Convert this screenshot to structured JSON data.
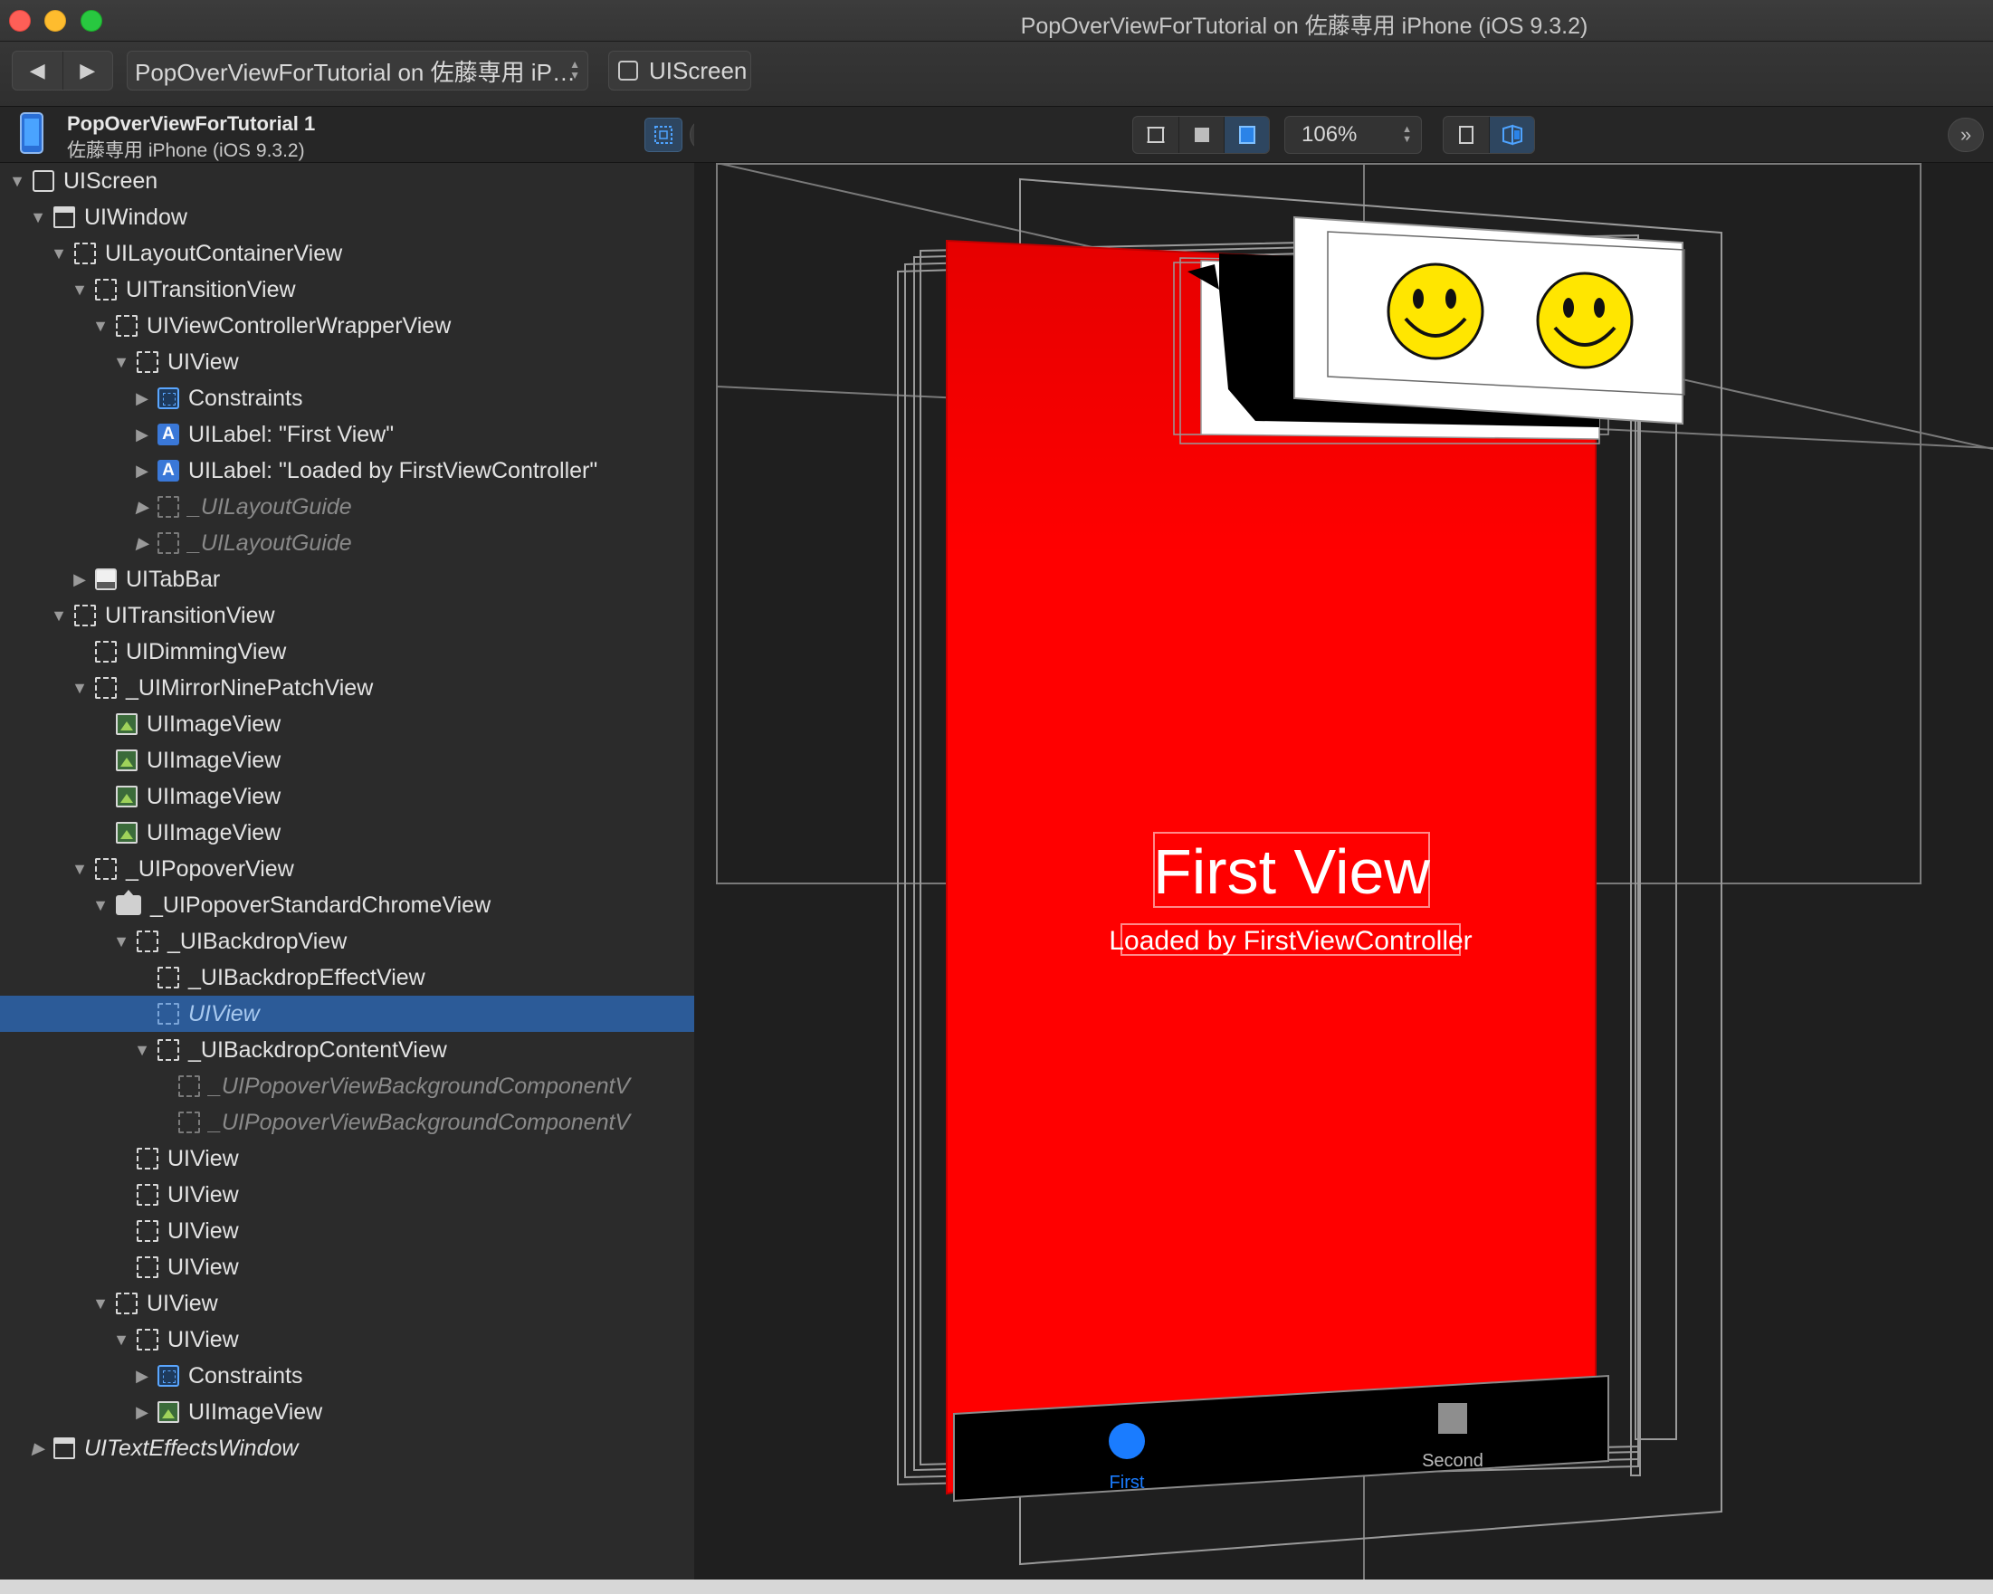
{
  "window": {
    "title": "PopOverViewForTutorial on 佐藤専用 iPhone (iOS 9.3.2)"
  },
  "toolbar": {
    "back_icon": "back-arrow-icon",
    "forward_icon": "forward-arrow-icon",
    "crumb_app": "PopOverViewForTutorial on 佐藤専用 iP…",
    "crumb_node": "UIScreen"
  },
  "sidebar": {
    "app_name": "PopOverViewForTutorial 1",
    "device_name": "佐藤専用 iPhone (iOS 9.3.2)"
  },
  "canvas_controls": {
    "zoom": "106%"
  },
  "tree": [
    {
      "label": "UIScreen",
      "depth": 0,
      "tri": "open",
      "icon": "solid"
    },
    {
      "label": "UIWindow",
      "depth": 1,
      "tri": "open",
      "icon": "window"
    },
    {
      "label": "UILayoutContainerView",
      "depth": 2,
      "tri": "open",
      "icon": "dashed"
    },
    {
      "label": "UITransitionView",
      "depth": 3,
      "tri": "open",
      "icon": "dashed"
    },
    {
      "label": "UIViewControllerWrapperView",
      "depth": 4,
      "tri": "open",
      "icon": "dashed"
    },
    {
      "label": "UIView",
      "depth": 5,
      "tri": "open",
      "icon": "dashed"
    },
    {
      "label": "Constraints",
      "depth": 6,
      "tri": "closed",
      "icon": "constraint"
    },
    {
      "label": "UILabel: \"First View\"",
      "depth": 6,
      "tri": "closed",
      "icon": "label"
    },
    {
      "label": "UILabel: \"Loaded by FirstViewController\"",
      "depth": 6,
      "tri": "closed",
      "icon": "label"
    },
    {
      "label": "_UILayoutGuide",
      "depth": 6,
      "tri": "closed",
      "icon": "dashed",
      "style": "dim"
    },
    {
      "label": "_UILayoutGuide",
      "depth": 6,
      "tri": "closed",
      "icon": "dashed",
      "style": "dim"
    },
    {
      "label": "UITabBar",
      "depth": 3,
      "tri": "closed",
      "icon": "tabbar"
    },
    {
      "label": "UITransitionView",
      "depth": 2,
      "tri": "open",
      "icon": "dashed"
    },
    {
      "label": "UIDimmingView",
      "depth": 3,
      "tri": "none",
      "icon": "dashed"
    },
    {
      "label": "_UIMirrorNinePatchView",
      "depth": 3,
      "tri": "open",
      "icon": "dashed"
    },
    {
      "label": "UIImageView",
      "depth": 4,
      "tri": "none",
      "icon": "image"
    },
    {
      "label": "UIImageView",
      "depth": 4,
      "tri": "none",
      "icon": "image"
    },
    {
      "label": "UIImageView",
      "depth": 4,
      "tri": "none",
      "icon": "image"
    },
    {
      "label": "UIImageView",
      "depth": 4,
      "tri": "none",
      "icon": "image"
    },
    {
      "label": "_UIPopoverView",
      "depth": 3,
      "tri": "open",
      "icon": "dashed"
    },
    {
      "label": "_UIPopoverStandardChromeView",
      "depth": 4,
      "tri": "open",
      "icon": "chrome"
    },
    {
      "label": "_UIBackdropView",
      "depth": 5,
      "tri": "open",
      "icon": "dashed"
    },
    {
      "label": "_UIBackdropEffectView",
      "depth": 6,
      "tri": "none",
      "icon": "dashed"
    },
    {
      "label": "UIView",
      "depth": 6,
      "tri": "none",
      "icon": "dashed",
      "style": "selected"
    },
    {
      "label": "_UIBackdropContentView",
      "depth": 6,
      "tri": "open",
      "icon": "dashed"
    },
    {
      "label": "_UIPopoverViewBackgroundComponentV",
      "depth": 7,
      "tri": "none",
      "icon": "dashed",
      "style": "dim"
    },
    {
      "label": "_UIPopoverViewBackgroundComponentV",
      "depth": 7,
      "tri": "none",
      "icon": "dashed",
      "style": "dim"
    },
    {
      "label": "UIView",
      "depth": 5,
      "tri": "none",
      "icon": "dashed"
    },
    {
      "label": "UIView",
      "depth": 5,
      "tri": "none",
      "icon": "dashed"
    },
    {
      "label": "UIView",
      "depth": 5,
      "tri": "none",
      "icon": "dashed"
    },
    {
      "label": "UIView",
      "depth": 5,
      "tri": "none",
      "icon": "dashed"
    },
    {
      "label": "UIView",
      "depth": 4,
      "tri": "open",
      "icon": "dashed"
    },
    {
      "label": "UIView",
      "depth": 5,
      "tri": "open",
      "icon": "dashed"
    },
    {
      "label": "Constraints",
      "depth": 6,
      "tri": "closed",
      "icon": "constraint"
    },
    {
      "label": "UIImageView",
      "depth": 6,
      "tri": "closed",
      "icon": "image"
    },
    {
      "label": "UITextEffectsWindow",
      "depth": 1,
      "tri": "closed",
      "icon": "window",
      "style": "italic"
    }
  ],
  "scene": {
    "first_view_label": "First View",
    "loaded_label": "Loaded by FirstViewController",
    "tab_first": "First",
    "tab_second": "Second",
    "colors": {
      "view_bg": "#ff0000",
      "tab_bg": "#000000",
      "tab_active": "#1a7cff",
      "tab_inactive": "#8e8e8e",
      "smiley": "#ffe600"
    }
  }
}
